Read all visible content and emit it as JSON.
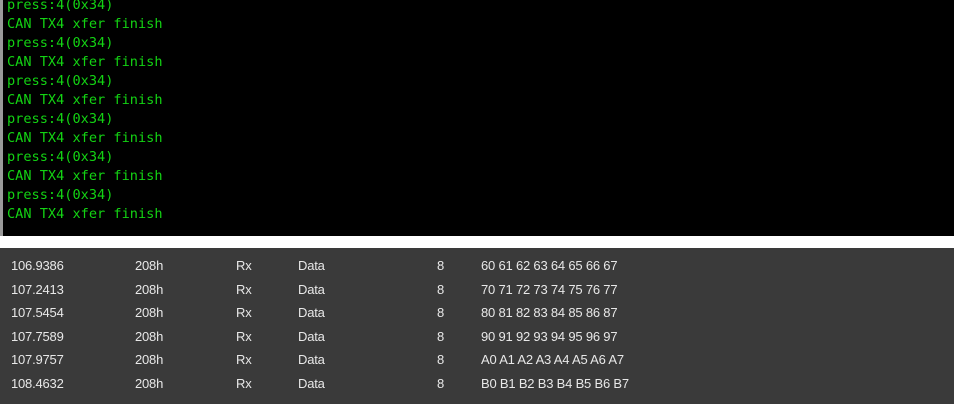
{
  "terminal": {
    "lines": [
      "press:4(0x34)",
      "CAN TX4 xfer finish",
      "press:4(0x34)",
      "CAN TX4 xfer finish",
      "press:4(0x34)",
      "CAN TX4 xfer finish",
      "press:4(0x34)",
      "CAN TX4 xfer finish",
      "press:4(0x34)",
      "CAN TX4 xfer finish",
      "press:4(0x34)",
      "CAN TX4 xfer finish"
    ],
    "text_color": "#13d313",
    "background": "#000000"
  },
  "can_log": {
    "background": "#3a3a3a",
    "rows": [
      {
        "time": "106.9386",
        "id": "208h",
        "dir": "Rx",
        "type": "Data",
        "dlc": "8",
        "data": "60 61 62 63 64 65 66 67"
      },
      {
        "time": "107.2413",
        "id": "208h",
        "dir": "Rx",
        "type": "Data",
        "dlc": "8",
        "data": "70 71 72 73 74 75 76 77"
      },
      {
        "time": "107.5454",
        "id": "208h",
        "dir": "Rx",
        "type": "Data",
        "dlc": "8",
        "data": "80 81 82 83 84 85 86 87"
      },
      {
        "time": "107.7589",
        "id": "208h",
        "dir": "Rx",
        "type": "Data",
        "dlc": "8",
        "data": "90 91 92 93 94 95 96 97"
      },
      {
        "time": "107.9757",
        "id": "208h",
        "dir": "Rx",
        "type": "Data",
        "dlc": "8",
        "data": "A0 A1 A2 A3 A4 A5 A6 A7"
      },
      {
        "time": "108.4632",
        "id": "208h",
        "dir": "Rx",
        "type": "Data",
        "dlc": "8",
        "data": "B0 B1 B2 B3 B4 B5 B6 B7"
      }
    ]
  }
}
